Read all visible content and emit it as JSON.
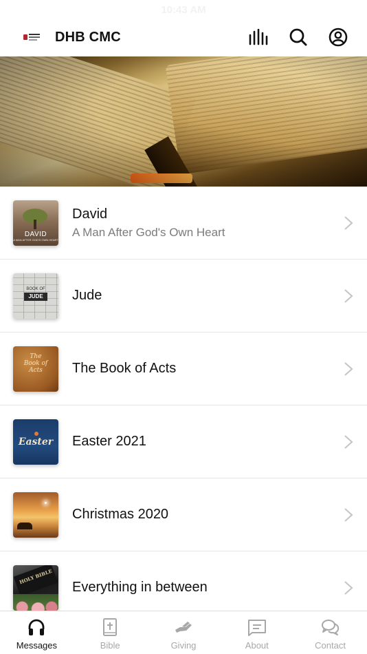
{
  "status": {
    "time": "10:43 AM"
  },
  "header": {
    "title": "DHB CMC",
    "actions": [
      {
        "icon": "bars-chart-icon"
      },
      {
        "icon": "search-icon"
      },
      {
        "icon": "user-account-icon"
      }
    ]
  },
  "hero": {
    "image": "open-bible-photo"
  },
  "series": [
    {
      "title": "David",
      "subtitle": "A Man After God's Own Heart",
      "thumb": "david",
      "thumb_text": "DAVID",
      "thumb_small": "A MAN AFTER GOD'S OWN HEART"
    },
    {
      "title": "Jude",
      "subtitle": "",
      "thumb": "jude",
      "thumb_text": "JUDE",
      "thumb_small": "BOOK OF"
    },
    {
      "title": "The Book of Acts",
      "subtitle": "",
      "thumb": "acts",
      "thumb_text": "The Book of Acts"
    },
    {
      "title": "Easter 2021",
      "subtitle": "",
      "thumb": "easter",
      "thumb_text": "Easter"
    },
    {
      "title": "Christmas 2020",
      "subtitle": "",
      "thumb": "christmas"
    },
    {
      "title": "Everything in between",
      "subtitle": "",
      "thumb": "bible",
      "thumb_text": "HOLY BIBLE"
    }
  ],
  "tabs": [
    {
      "label": "Messages",
      "icon": "headphones-icon",
      "active": true
    },
    {
      "label": "Bible",
      "icon": "bible-icon",
      "active": false
    },
    {
      "label": "Giving",
      "icon": "giving-hand-icon",
      "active": false
    },
    {
      "label": "About",
      "icon": "about-card-icon",
      "active": false
    },
    {
      "label": "Contact",
      "icon": "chat-bubbles-icon",
      "active": false
    }
  ],
  "colors": {
    "active_tab": "#111111",
    "inactive_tab": "#a7a7a7",
    "divider": "#e6e6e6",
    "subtitle": "#7b7b7b"
  }
}
